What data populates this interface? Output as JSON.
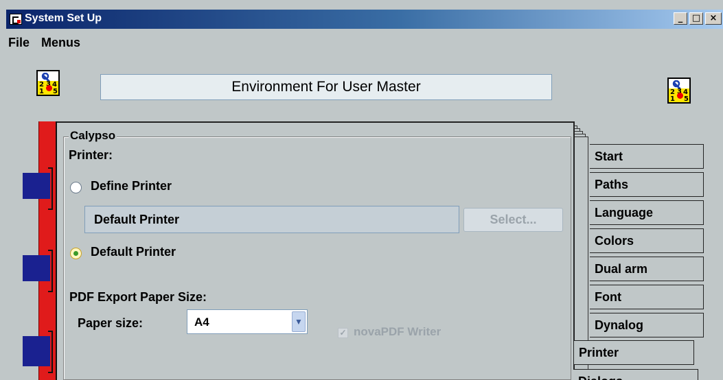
{
  "window": {
    "title": "System Set Up",
    "minimize": "_",
    "maximize": "□",
    "close": "×"
  },
  "menu": [
    "File",
    "Menus"
  ],
  "header": {
    "title": "Environment For User Master",
    "icon_digits": [
      "2",
      "3",
      "4",
      "1",
      "5"
    ]
  },
  "group": {
    "title": "Calypso",
    "printer_label": "Printer:",
    "define_printer_label": "Define Printer",
    "printer_field_value": "Default Printer",
    "select_button": "Select...",
    "default_printer_label": "Default Printer",
    "pdf_label": "PDF Export Paper Size:",
    "paper_size_label": "Paper size:",
    "paper_size_value": "A4",
    "nova_label": "novaPDF Writer",
    "nova_checked": true
  },
  "tabs": [
    {
      "label": "Start"
    },
    {
      "label": "Paths"
    },
    {
      "label": "Language"
    },
    {
      "label": "Colors"
    },
    {
      "label": "Dual arm"
    },
    {
      "label": "Font"
    },
    {
      "label": "Dynalog"
    },
    {
      "label": "Printer",
      "active": true
    },
    {
      "label": "Dialogs"
    }
  ],
  "colors": {
    "spine": "#e01b1b",
    "rings": "#1a2190",
    "titlebar": "#0a246a"
  }
}
